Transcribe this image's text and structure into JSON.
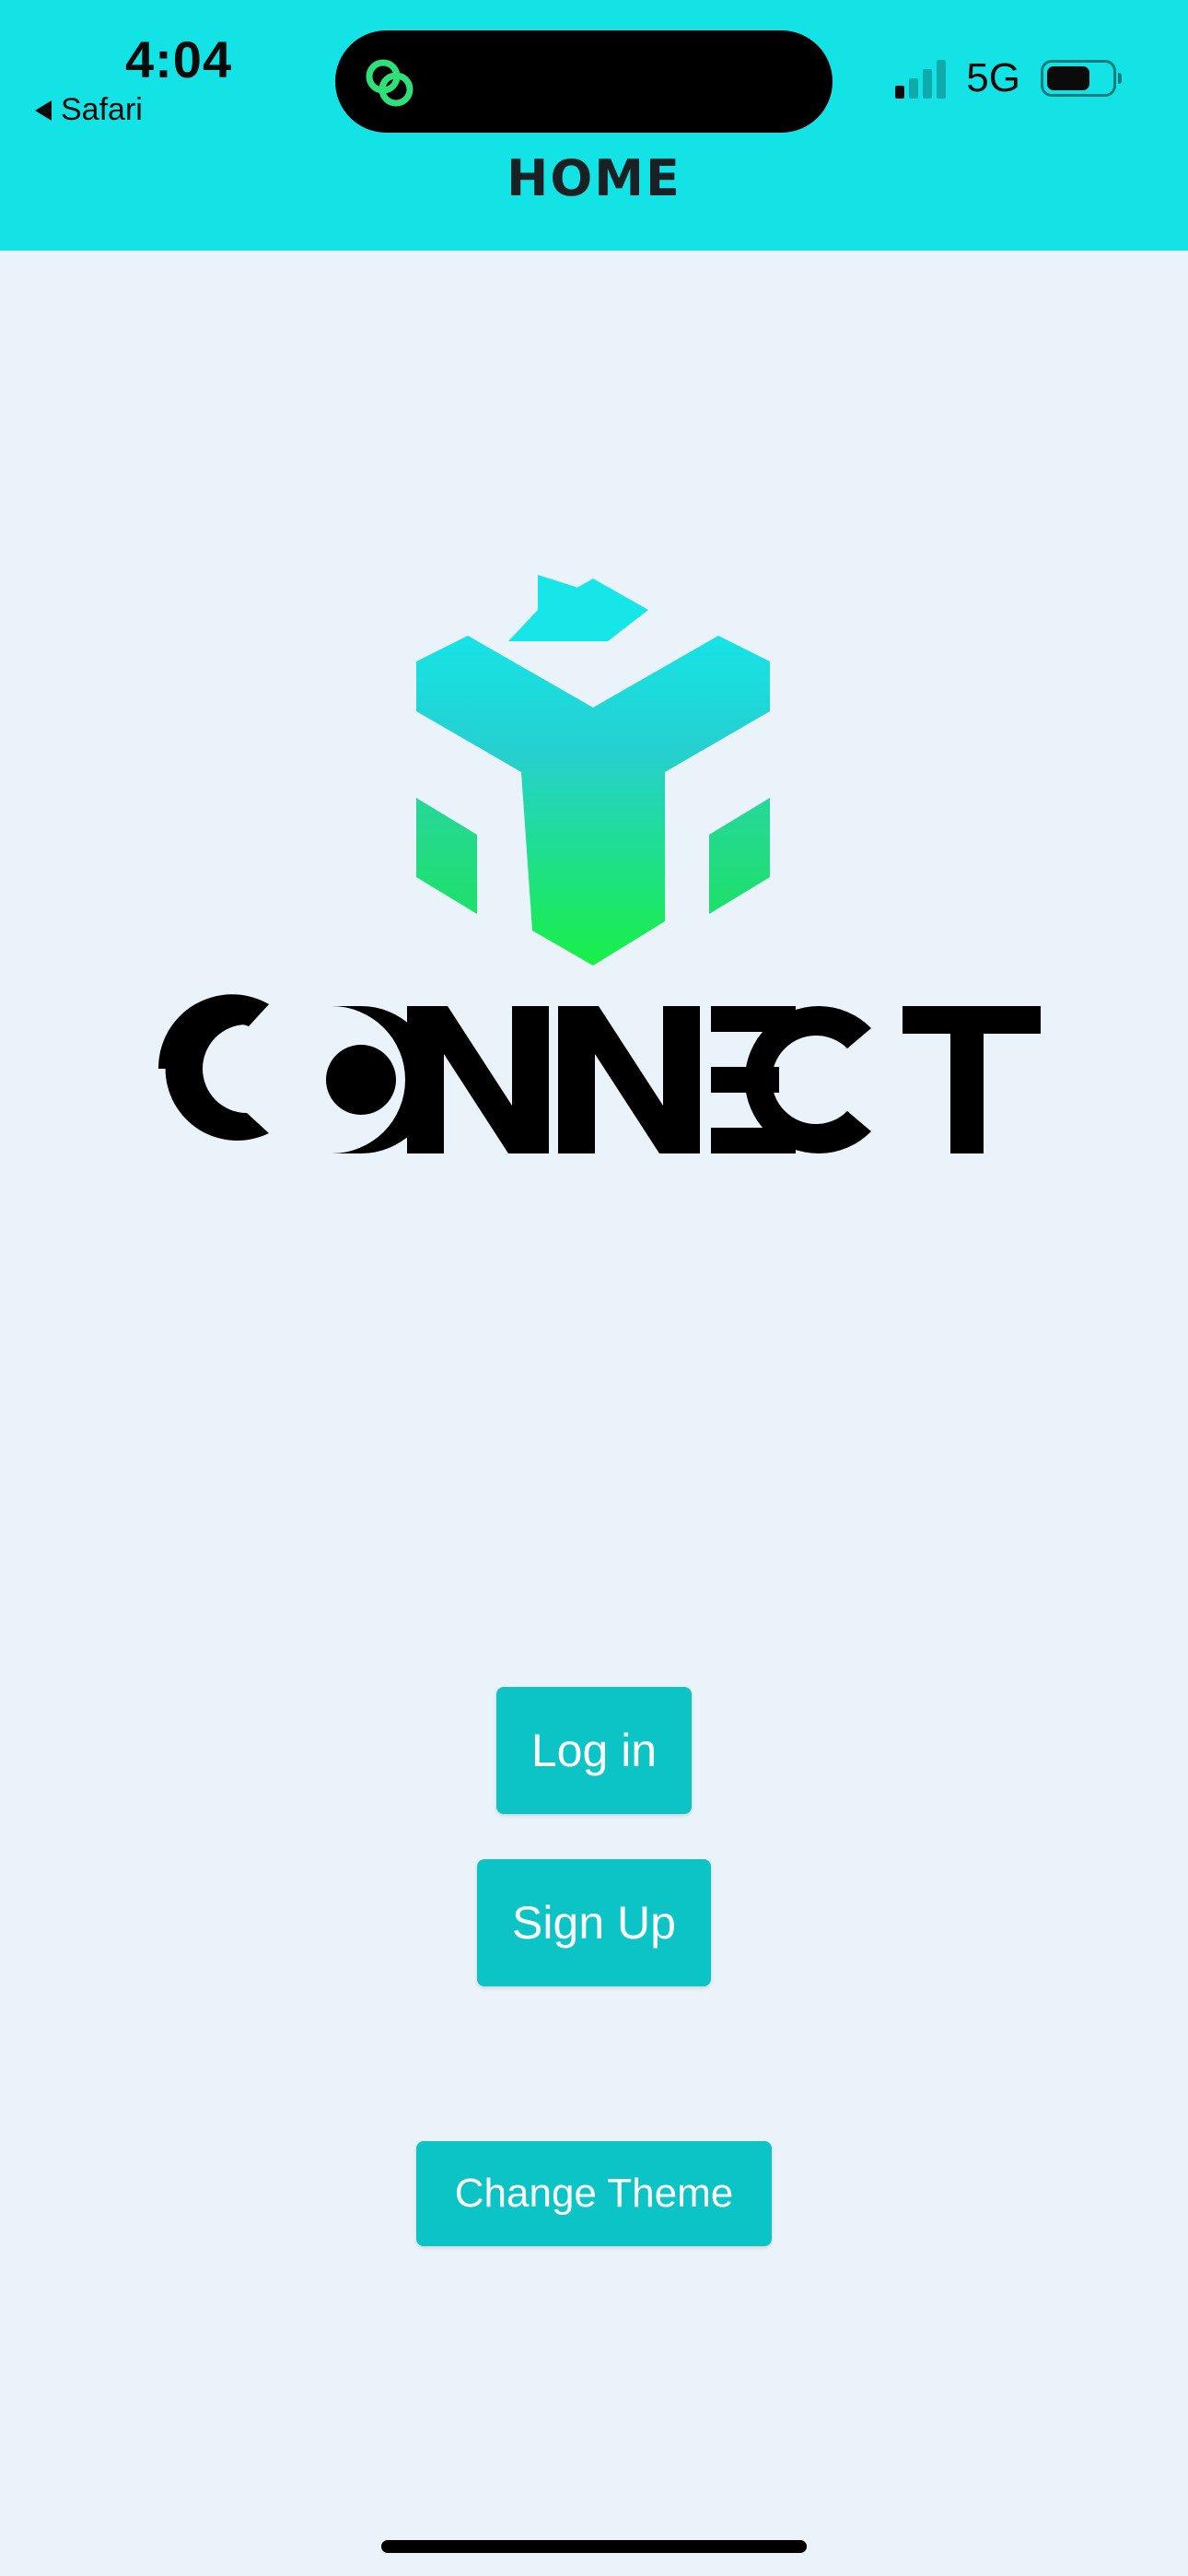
{
  "status_bar": {
    "time": "4:04",
    "back_app": "Safari",
    "network": "5G",
    "signal_bars_active": 1,
    "signal_bars_total": 4,
    "battery_level": 0.6,
    "island_icon": "link-rings-icon"
  },
  "header": {
    "title": "HOME",
    "background": "#14e3e6"
  },
  "logo": {
    "wordmark": "CONNECT",
    "mark_gradient": [
      "#16e3e6",
      "#19ef47"
    ]
  },
  "buttons": {
    "login": "Log in",
    "signup": "Sign Up",
    "change_theme": "Change Theme",
    "color": "#0cc4c6"
  },
  "theme": {
    "page_background": "#eaf3fa"
  }
}
